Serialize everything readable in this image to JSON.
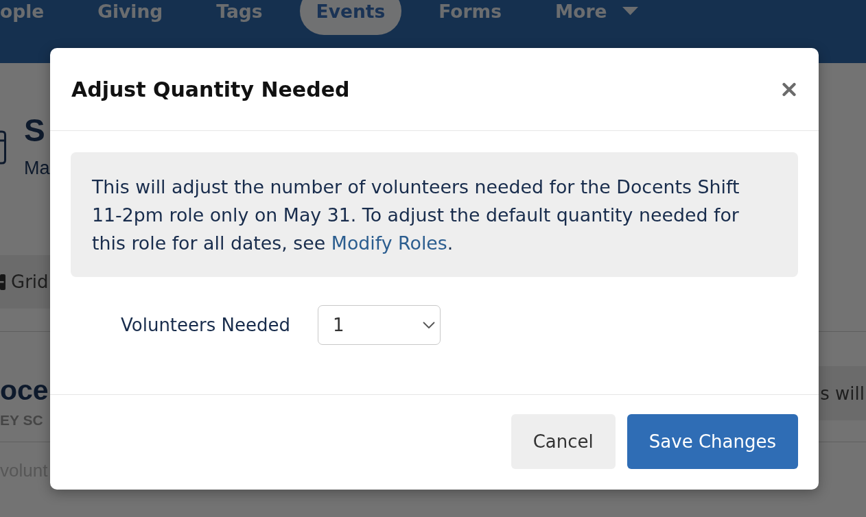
{
  "nav": {
    "items": [
      {
        "label": "ople",
        "selected": false,
        "dropdown": false
      },
      {
        "label": "Giving",
        "selected": false,
        "dropdown": false
      },
      {
        "label": "Tags",
        "selected": false,
        "dropdown": false
      },
      {
        "label": "Events",
        "selected": true,
        "dropdown": false
      },
      {
        "label": "Forms",
        "selected": false,
        "dropdown": false
      },
      {
        "label": "More",
        "selected": false,
        "dropdown": true
      }
    ]
  },
  "page": {
    "title": "S",
    "subtitle": "Ma",
    "view_tab": "Grid",
    "role": {
      "title": "oce",
      "subtitle": "EY SC",
      "note": "volunt"
    },
    "side_note": "s will"
  },
  "dialog": {
    "title": "Adjust Quantity Needed",
    "notice": {
      "text_before": "This will adjust the number of volunteers needed for the Docents Shift 11-2pm role only on May 31. To adjust the default quantity needed for this role for all dates, see ",
      "link": "Modify Roles",
      "text_after": "."
    },
    "field": {
      "label": "Volunteers Needed",
      "value": "1"
    },
    "buttons": [
      {
        "label": "Cancel",
        "kind": "secondary"
      },
      {
        "label": "Save Changes",
        "kind": "primary"
      }
    ]
  }
}
